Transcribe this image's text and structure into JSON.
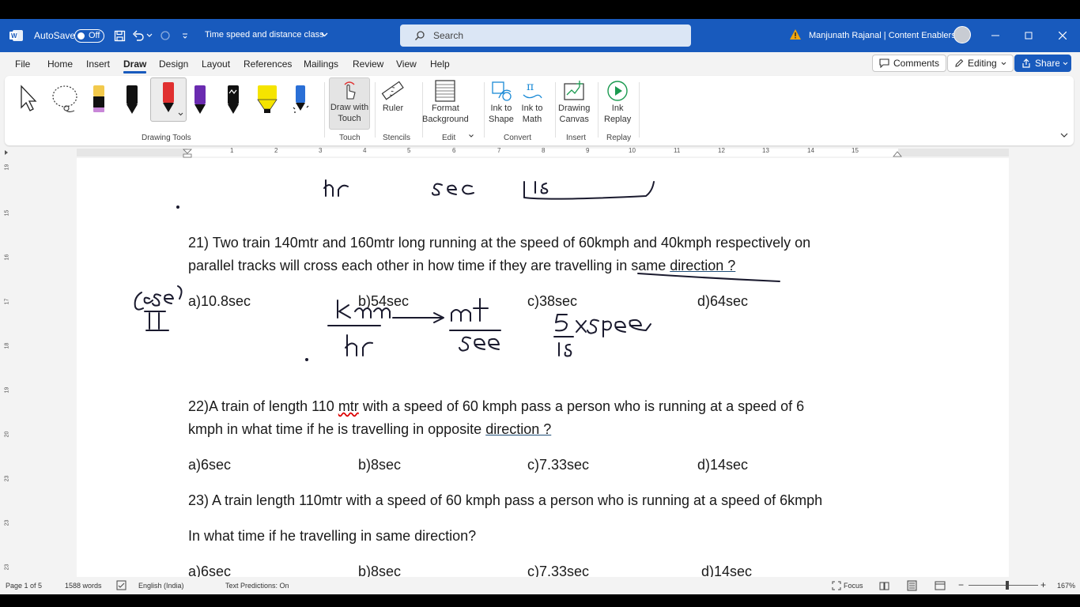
{
  "titlebar": {
    "autosave": "AutoSave",
    "toggle_state": "Off",
    "doc_title": "Time speed and distance class",
    "search_placeholder": "Search",
    "user": "Manjunath Rajanal | Content Enablers"
  },
  "menu": {
    "tabs": [
      "File",
      "Home",
      "Insert",
      "Draw",
      "Design",
      "Layout",
      "References",
      "Mailings",
      "Review",
      "View",
      "Help"
    ],
    "active_tab": "Draw",
    "comments": "Comments",
    "editing": "Editing",
    "share": "Share"
  },
  "ribbon": {
    "draw_with_touch_1": "Draw with",
    "draw_with_touch_2": "Touch",
    "ruler": "Ruler",
    "format_bg_1": "Format",
    "format_bg_2": "Background",
    "ink_to_shape_1": "Ink to",
    "ink_to_shape_2": "Shape",
    "ink_to_math_1": "Ink to",
    "ink_to_math_2": "Math",
    "drawing_canvas_1": "Drawing",
    "drawing_canvas_2": "Canvas",
    "ink_replay_1": "Ink",
    "ink_replay_2": "Replay",
    "groups": {
      "drawing_tools": "Drawing Tools",
      "touch": "Touch",
      "stencils": "Stencils",
      "edit": "Edit",
      "convert": "Convert",
      "insert": "Insert",
      "replay": "Replay"
    },
    "pen_colors": [
      "#f2c94c",
      "#111111",
      "#e03030",
      "#6a2bb0",
      "#111111",
      "#f5e400",
      "#2a6fd6"
    ]
  },
  "ruler": {
    "numbers": [
      "1",
      "2",
      "3",
      "4",
      "5",
      "6",
      "7",
      "8",
      "9",
      "10",
      "11",
      "12",
      "13",
      "14",
      "15"
    ],
    "vnumbers": [
      "19",
      "15",
      "16",
      "17",
      "18",
      "19",
      "20",
      "23",
      "23",
      "23"
    ]
  },
  "document": {
    "q21_line1": "21) Two train 140mtr and 160mtr long running at the speed of 60kmph and 40kmph respectively on",
    "q21_line2_a": "parallel tracks will cross each other in how time if they are travelling in same ",
    "q21_line2_b": "direction ?",
    "q21_options": [
      "a)10.8sec",
      "b)54sec",
      "c)38sec",
      "d)64sec"
    ],
    "q22_line1_a": "22)A train of length 110 ",
    "q22_line1_b": "mtr",
    "q22_line1_c": " with a speed of 60 kmph pass a person who is running at a speed of 6",
    "q22_line2_a": "kmph in what time if he is travelling in opposite ",
    "q22_line2_b": "direction ?",
    "q22_options": [
      "a)6sec",
      "b)8sec",
      "c)7.33sec",
      "d)14sec"
    ],
    "q23_line1": "23) A train length 110mtr with a speed of 60 kmph pass a person who is running at a speed of 6kmph",
    "q23_line2": "In what time if he travelling in same direction?",
    "q23_options": [
      "a)6sec",
      "b)8sec",
      "c)7.33sec",
      "d)14sec"
    ]
  },
  "status": {
    "page": "Page 1 of 5",
    "words": "1588 words",
    "language": "English (India)",
    "predictions": "Text Predictions: On",
    "focus": "Focus",
    "zoom": "167%"
  },
  "colors": {
    "brand": "#185abd",
    "ink": "#1a1a2e"
  }
}
